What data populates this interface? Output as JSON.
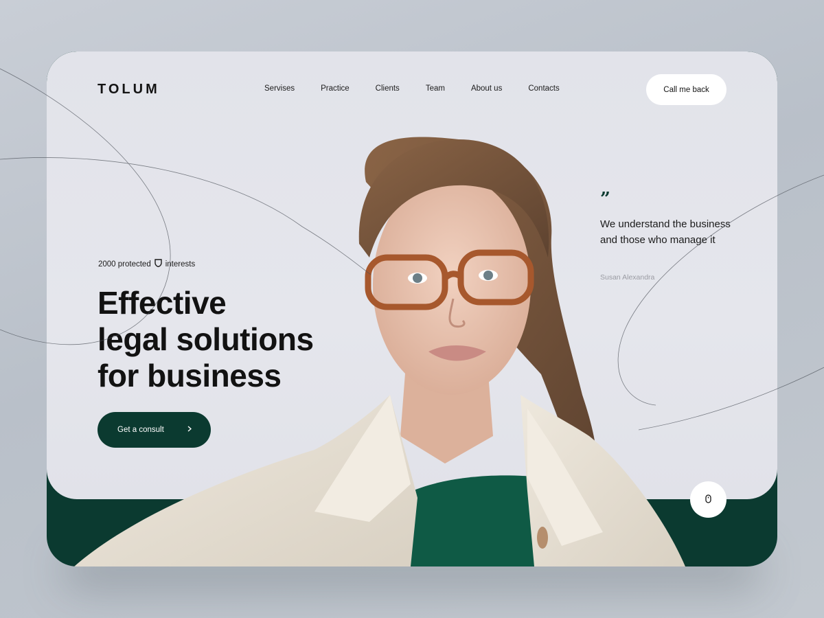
{
  "brand": {
    "logo_text": "TOLUM"
  },
  "nav": {
    "items": [
      {
        "label": "Servises"
      },
      {
        "label": "Practice"
      },
      {
        "label": "Clients"
      },
      {
        "label": "Team"
      },
      {
        "label": "About us"
      },
      {
        "label": "Contacts"
      }
    ],
    "cta_label": "Call me back"
  },
  "hero": {
    "tagline_count": "2000 protected",
    "tagline_icon": "shield-icon",
    "tagline_rest": "interests",
    "headline": [
      "Effective",
      "legal solutions",
      "for business"
    ],
    "cta_label": "Get a consult",
    "cta_icon": "chevron-right-icon"
  },
  "testimonial": {
    "quote_icon": "quote-icon",
    "text": "We understand the business and those who manage it",
    "author": "Susan Alexandra"
  },
  "scroll": {
    "icon": "mouse-icon"
  },
  "colors": {
    "accent": "#0b3a30",
    "card_background": "#e4e5eb",
    "page_background": "#c0c6ce",
    "text": "#121212",
    "muted": "#9a9ca3"
  }
}
